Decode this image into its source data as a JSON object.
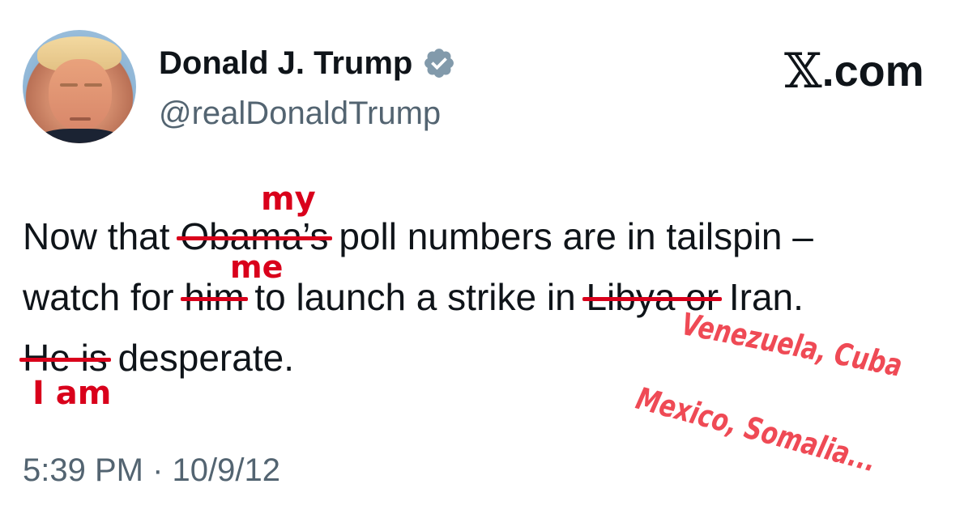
{
  "author": {
    "display_name": "Donald J. Trump",
    "handle": "@realDonaldTrump",
    "verified_icon": "verified-badge-icon",
    "avatar": "profile-photo"
  },
  "brand": {
    "logo_icon": "x-logo-icon",
    "logo_glyph": "𝕏",
    "domain": ".com"
  },
  "tweet": {
    "line1": {
      "before": "Now that ",
      "struck": "Obama’s",
      "after": " poll numbers are in tailspin –"
    },
    "line2": {
      "before": "watch for ",
      "struck1": "him",
      "middle": " to launch a strike in ",
      "struck2": "Libya or",
      "after": " Iran."
    },
    "line3": {
      "struck": "He is",
      "after": " desperate."
    },
    "timestamp": "5:39 PM · 10/9/12"
  },
  "annotations": {
    "replace_obama": "my",
    "replace_him": "me",
    "replace_he_is": "I am",
    "handwritten_1": "Venezuela, Cuba",
    "handwritten_2": "Mexico, Somalia..."
  },
  "colors": {
    "edit_red": "#d9001b",
    "handwriting_red": "#ef4a55",
    "secondary_text": "#536471",
    "verified_gray": "#829aab"
  }
}
